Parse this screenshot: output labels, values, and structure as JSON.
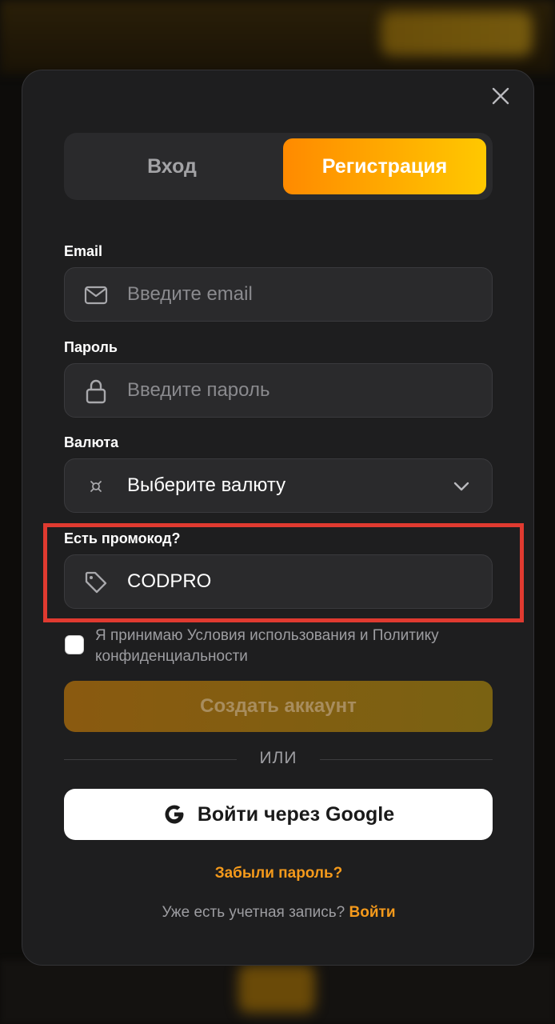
{
  "tabs": [
    {
      "label": "Вход",
      "active": false
    },
    {
      "label": "Регистрация",
      "active": true
    }
  ],
  "form": {
    "email": {
      "label": "Email",
      "placeholder": "Введите email",
      "icon": "mail-icon"
    },
    "password": {
      "label": "Пароль",
      "placeholder": "Введите пароль",
      "icon": "lock-icon"
    },
    "currency": {
      "label": "Валюта",
      "value": "Выберите валюту",
      "icon": "currency-icon"
    },
    "promo": {
      "label": "Есть промокод?",
      "value": "CODPRO",
      "icon": "tag-icon"
    }
  },
  "terms": {
    "text": "Я принимаю Условия использования и Политику конфиденциальности",
    "checked": false
  },
  "create_button": "Создать аккаунт",
  "divider_text": "ИЛИ",
  "google_button": "Войти через Google",
  "forgot_link": "Забыли пароль?",
  "signin": {
    "prompt": "Уже есть учетная запись?",
    "link": "Войти"
  },
  "colors": {
    "accent_start": "#ff8a00",
    "accent_end": "#ffc800",
    "link": "#f59a1b",
    "highlight": "#e03a30",
    "modal_bg": "#1e1e1f"
  }
}
